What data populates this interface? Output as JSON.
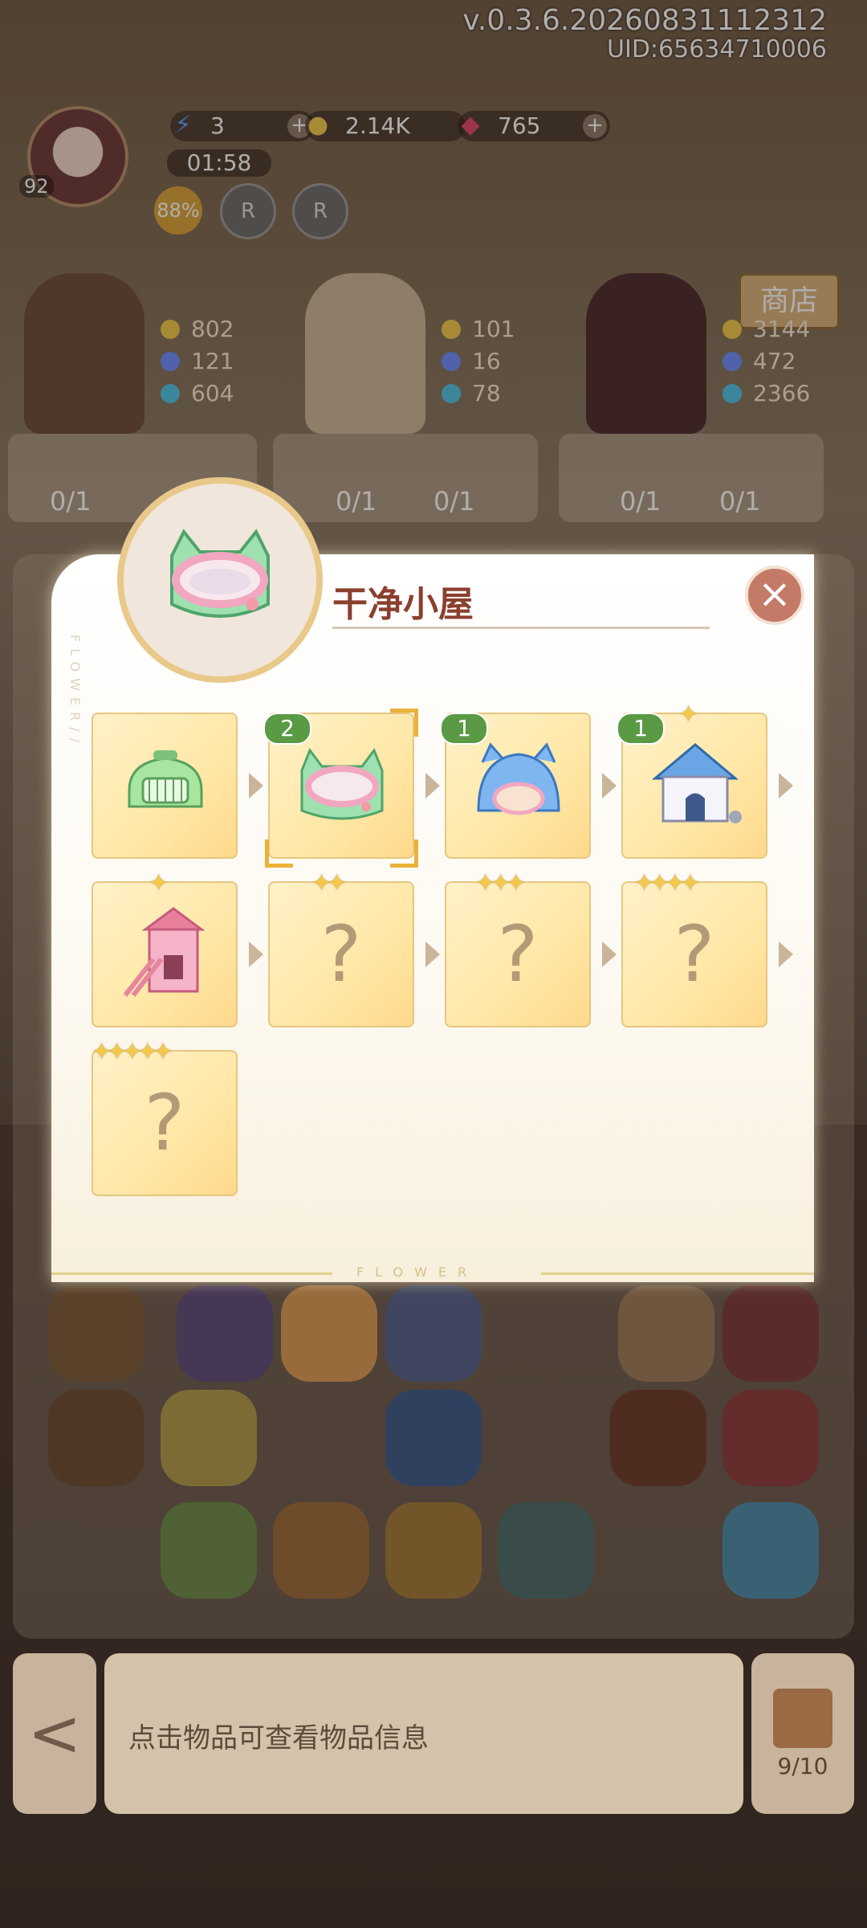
{
  "header": {
    "version": "v.0.3.6.20260831112312",
    "uid": "UID:65634710006",
    "level": "92",
    "energy": "3",
    "timer": "01:58",
    "coins": "2.14K",
    "gems": "765",
    "progress_percent": "88%",
    "badge_label": "R"
  },
  "shop_sign": "商店",
  "characters": [
    {
      "coins": "802",
      "bottles": "121",
      "butterflies": "604"
    },
    {
      "coins": "101",
      "bottles": "16",
      "butterflies": "78"
    },
    {
      "coins": "3144",
      "bottles": "472",
      "butterflies": "2366"
    }
  ],
  "slot_counts": [
    "0/1",
    "0/1",
    "0/1",
    "0/1",
    "0/1"
  ],
  "modal": {
    "title": "干净小屋",
    "close": "×",
    "side_word": "FLOWER//",
    "footer_word": "FLOWER",
    "cards": [
      {
        "known": true,
        "count": ""
      },
      {
        "known": true,
        "count": "2",
        "selected": true
      },
      {
        "known": true,
        "count": "1"
      },
      {
        "known": true,
        "count": "1",
        "stars": 1
      },
      {
        "known": true,
        "count": "",
        "stars": 1
      },
      {
        "known": false,
        "mark": "?",
        "stars": 2
      },
      {
        "known": false,
        "mark": "?",
        "stars": 3
      },
      {
        "known": false,
        "mark": "?",
        "stars": 4
      },
      {
        "known": false,
        "mark": "?",
        "stars": 5
      }
    ]
  },
  "bottom_bar": {
    "back": "<",
    "info_text": "点击物品可查看物品信息",
    "bag_count": "9/10"
  }
}
